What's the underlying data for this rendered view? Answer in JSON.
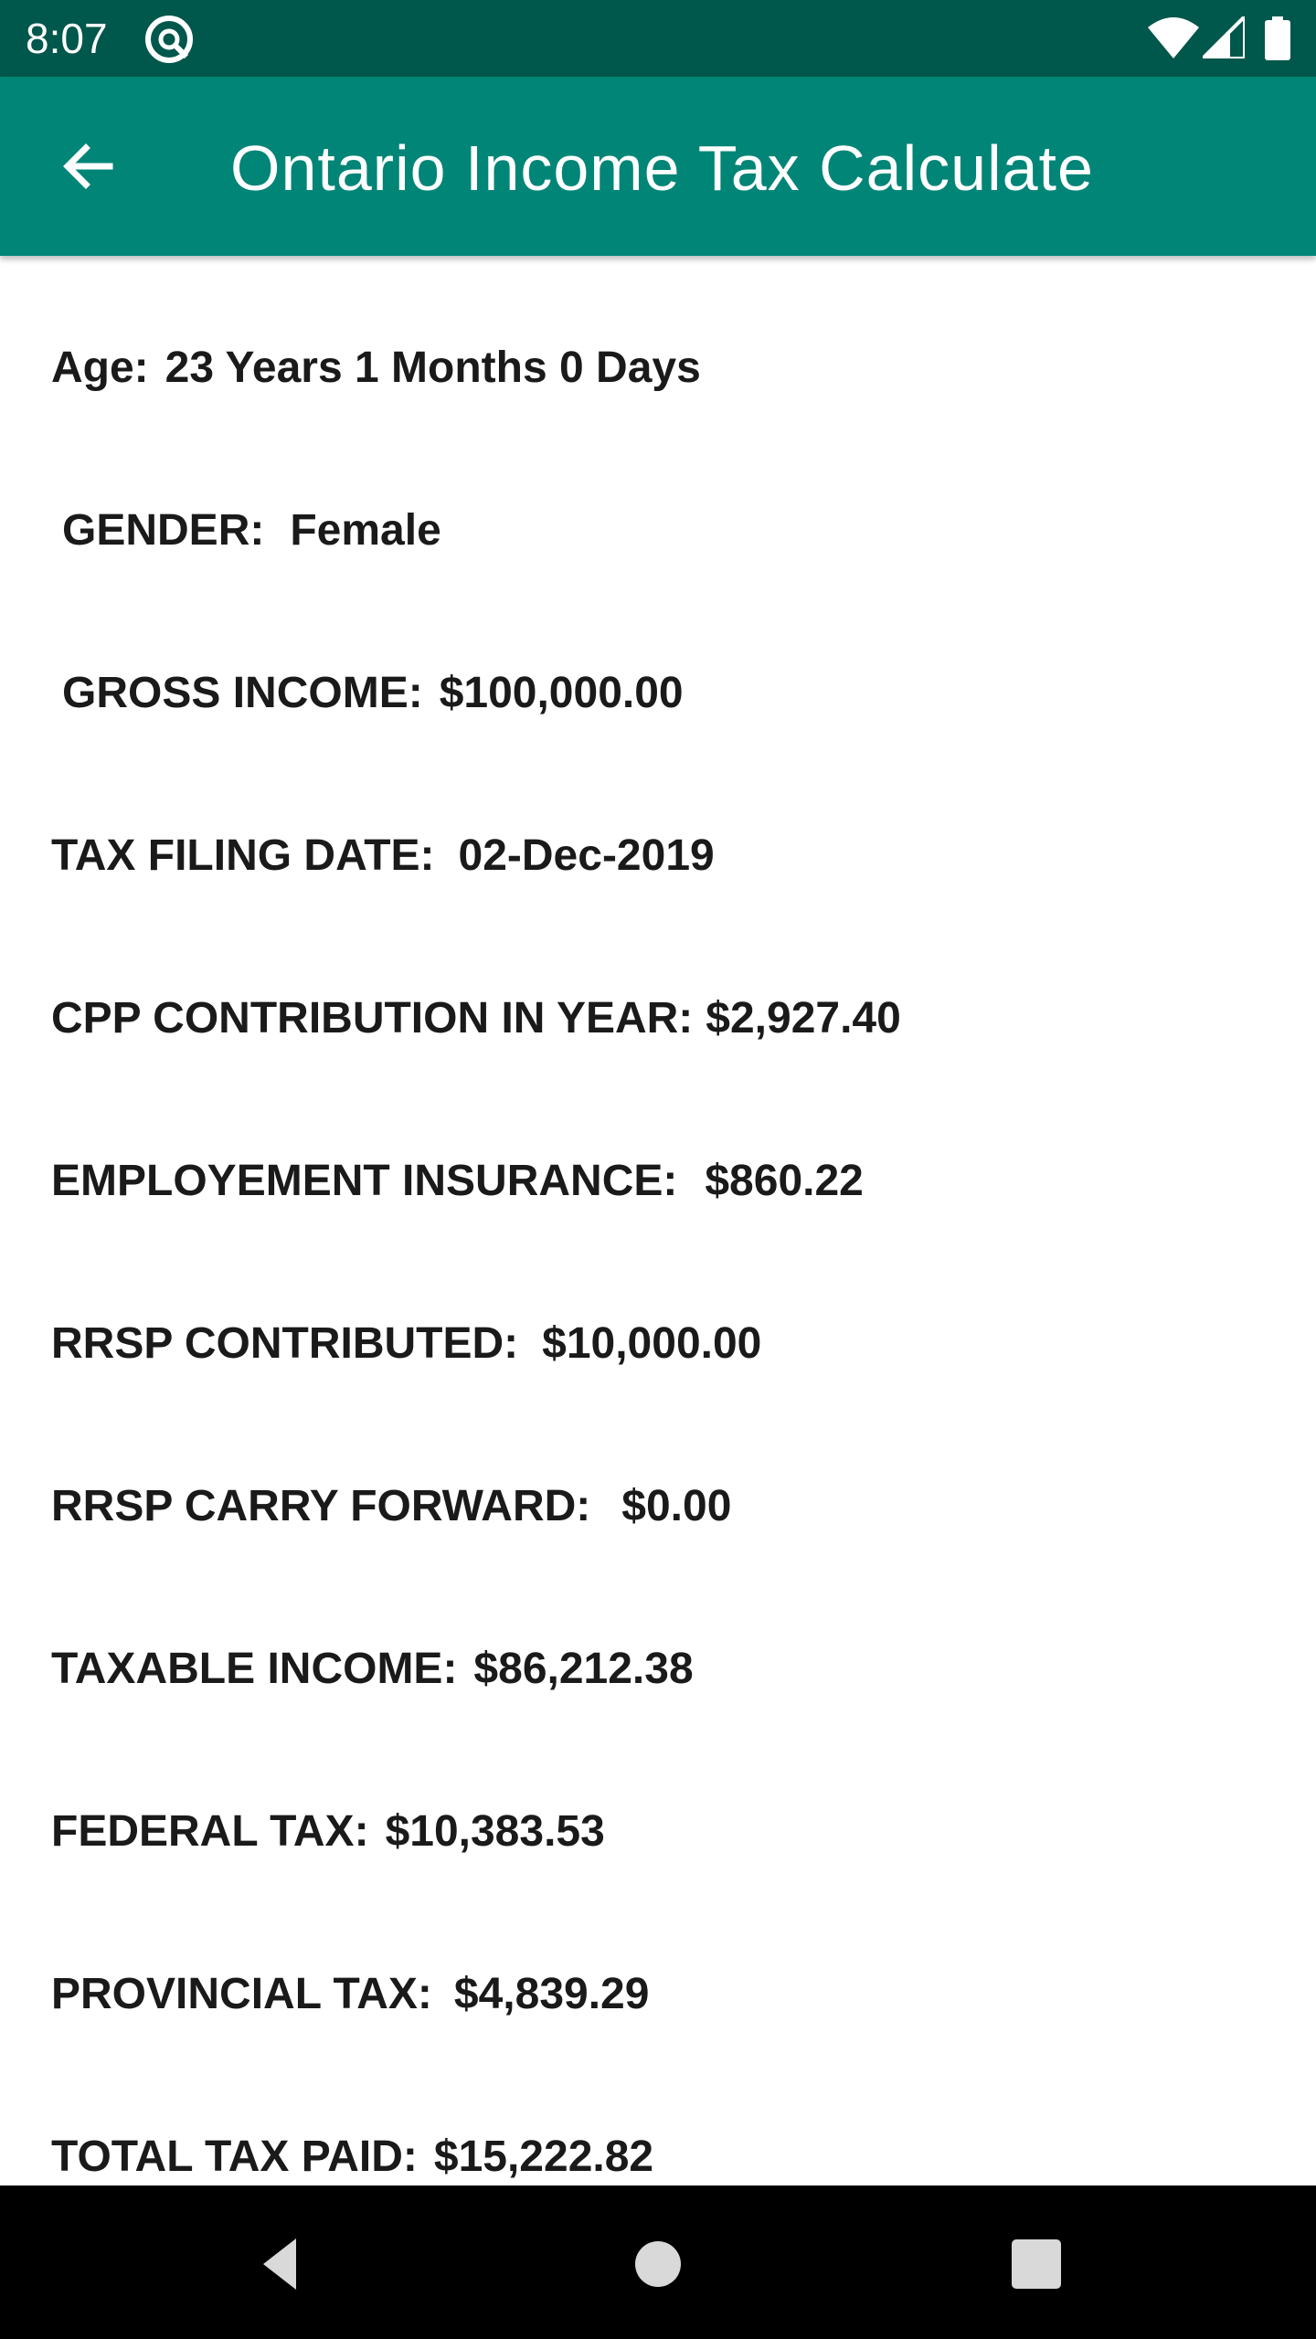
{
  "status_bar": {
    "time": "8:07",
    "app_icon": "at-sign-icon",
    "icons": [
      "wifi-icon",
      "cell-signal-icon",
      "battery-icon"
    ]
  },
  "app_bar": {
    "title": "Ontario Income Tax Calculate",
    "back_icon": "arrow-left-icon",
    "color": "#008577",
    "status_color": "#00574b"
  },
  "details": [
    {
      "label": "Age:",
      "value": "23 Years 1 Months 0 Days"
    },
    {
      "label": "GENDER:",
      "value": "Female"
    },
    {
      "label": "GROSS INCOME:",
      "value": "$100,000.00"
    },
    {
      "label": "TAX FILING DATE:",
      "value": "02-Dec-2019"
    },
    {
      "label": "CPP CONTRIBUTION IN YEAR:",
      "value": "$2,927.40"
    },
    {
      "label": "EMPLOYEMENT INSURANCE:",
      "value": "$860.22"
    },
    {
      "label": "RRSP CONTRIBUTED:",
      "value": "$10,000.00"
    },
    {
      "label": "RRSP CARRY FORWARD:",
      "value": "$0.00"
    },
    {
      "label": "TAXABLE INCOME:",
      "value": "$86,212.38"
    },
    {
      "label": "FEDERAL TAX:",
      "value": "$10,383.53"
    },
    {
      "label": "PROVINCIAL TAX:",
      "value": "$4,839.29"
    },
    {
      "label": "TOTAL TAX PAID:",
      "value": "$15,222.82"
    }
  ],
  "nav_bar": {
    "icons": [
      "nav-back-icon",
      "nav-home-icon",
      "nav-recents-icon"
    ]
  }
}
